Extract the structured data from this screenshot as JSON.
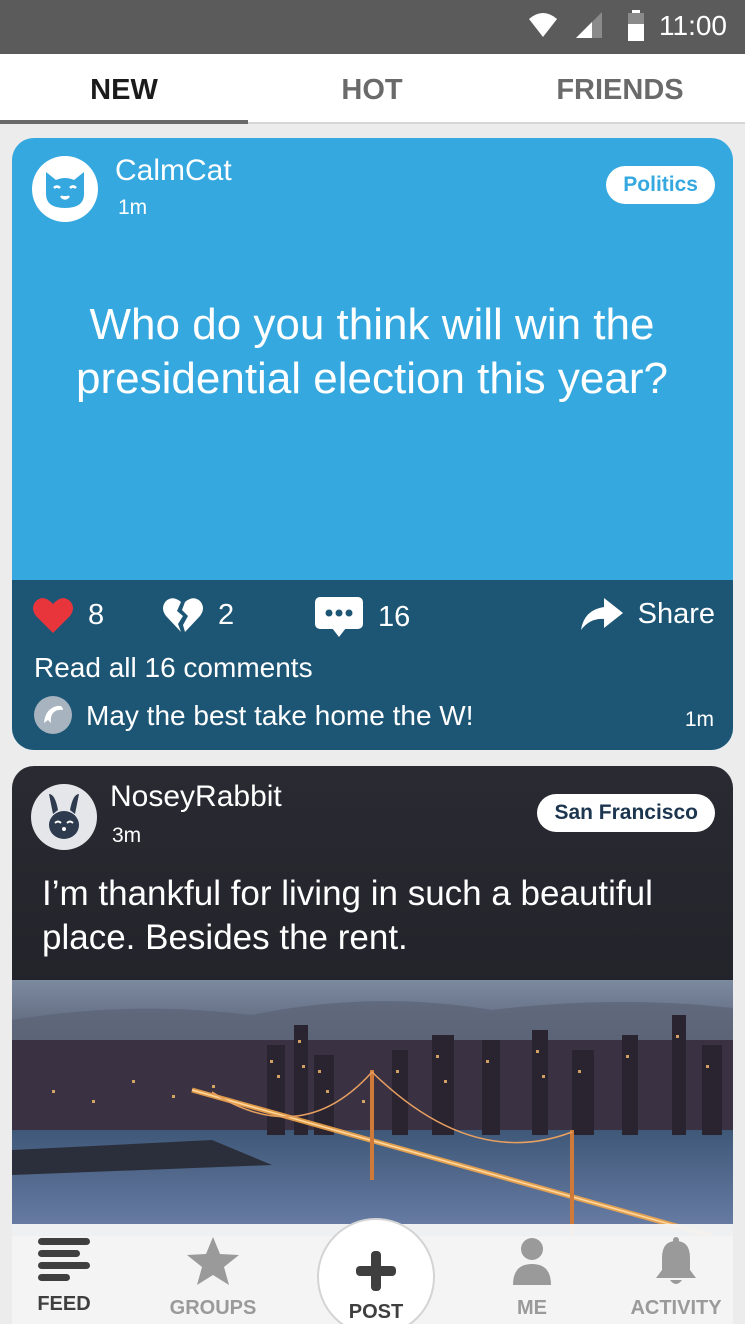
{
  "status_bar": {
    "time": "11:00"
  },
  "tabs": [
    {
      "label": "NEW",
      "active": true
    },
    {
      "label": "HOT",
      "active": false
    },
    {
      "label": "FRIENDS",
      "active": false
    }
  ],
  "posts": [
    {
      "username": "CalmCat",
      "time": "1m",
      "tag": "Politics",
      "avatar_icon": "cat-icon",
      "text": "Who do you think will win the presidential election this year?",
      "background_color": "#35a8df",
      "likes": "8",
      "dislikes": "2",
      "comments": "16",
      "share_label": "Share",
      "read_all_label": "Read all 16 comments",
      "top_comment": {
        "avatar_icon": "dolphin-icon",
        "text": "May the best take home the W!",
        "time": "1m"
      }
    },
    {
      "username": "NoseyRabbit",
      "time": "3m",
      "tag": "San Francisco",
      "avatar_icon": "rabbit-icon",
      "text": "I’m thankful for living in such a beautiful place. Besides the rent.",
      "image": "city-night-bridge-image"
    }
  ],
  "bottom_nav": [
    {
      "label": "FEED",
      "icon": "feed-icon",
      "active": true
    },
    {
      "label": "GROUPS",
      "icon": "star-icon",
      "active": false
    },
    {
      "label": "POST",
      "icon": "plus-icon",
      "active": false
    },
    {
      "label": "ME",
      "icon": "person-icon",
      "active": false
    },
    {
      "label": "ACTIVITY",
      "icon": "bell-icon",
      "active": false
    }
  ],
  "colors": {
    "accent_blue": "#35a8df",
    "footer_dark": "#1d5675",
    "heart_red": "#e8353c",
    "nav_active": "#3f3f3f",
    "nav_inactive": "#9a9a9a"
  }
}
